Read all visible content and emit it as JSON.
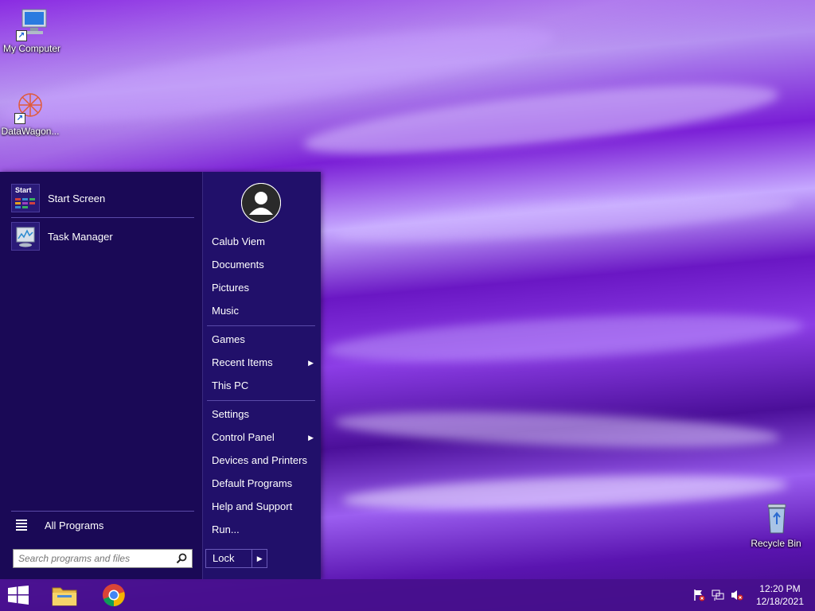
{
  "desktop": {
    "icons": [
      {
        "label": "My Computer",
        "icon": "computer-icon"
      },
      {
        "label": "DataWagon...",
        "icon": "datawagon-icon"
      },
      {
        "label": "Recycle Bin",
        "icon": "recycle-bin-icon"
      }
    ]
  },
  "start_menu": {
    "pinned": [
      {
        "label": "Start Screen",
        "icon_text": "Start",
        "icon": "start-screen-icon"
      },
      {
        "label": "Task Manager",
        "icon": "task-manager-icon"
      }
    ],
    "all_programs": "All Programs",
    "search": {
      "placeholder": "Search programs and files"
    },
    "user_name": "Calub Viem",
    "right_items": [
      {
        "label": "Documents"
      },
      {
        "label": "Pictures"
      },
      {
        "label": "Music"
      },
      {
        "label": "Games"
      },
      {
        "label": "Recent Items",
        "submenu": true
      },
      {
        "label": "This PC"
      },
      {
        "label": "Settings"
      },
      {
        "label": "Control Panel",
        "submenu": true
      },
      {
        "label": "Devices and Printers"
      },
      {
        "label": "Default Programs"
      },
      {
        "label": "Help and Support"
      },
      {
        "label": "Run..."
      }
    ],
    "lock": {
      "label": "Lock"
    }
  },
  "taskbar": {
    "buttons": [
      {
        "icon": "windows-logo-icon"
      },
      {
        "icon": "file-explorer-icon"
      },
      {
        "icon": "chrome-icon"
      }
    ],
    "tray": {
      "icons": [
        "action-center-flag-icon",
        "network-icon",
        "volume-muted-icon"
      ],
      "time": "12:20 PM",
      "date": "12/18/2021"
    }
  },
  "colors": {
    "start_menu_bg": "#1c0a5c",
    "taskbar_bg": "#460f8c",
    "accent": "#7a1fd6"
  }
}
